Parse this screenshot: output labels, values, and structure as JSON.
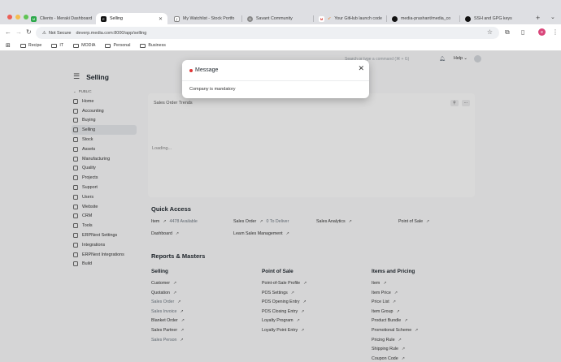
{
  "browser": {
    "tabs": [
      {
        "title": "Clients - Meraki Dashboard",
        "favicon_color": "#2ba84a",
        "favicon_glyph": "M"
      },
      {
        "title": "Selling",
        "favicon_color": "#111111",
        "favicon_glyph": "E",
        "active": true
      },
      {
        "title": "My Watchlist - Stock Portfo",
        "favicon_color": "#333333",
        "favicon_glyph": "ƒ"
      },
      {
        "title": "Savant Community",
        "favicon_color": "#888888",
        "favicon_glyph": "S"
      },
      {
        "title": "Your GitHub launch code",
        "favicon_color": "#ffffff",
        "favicon_glyph": "M"
      },
      {
        "title": "media-prashant/media_co",
        "favicon_color": "#111111",
        "favicon_glyph": "●"
      },
      {
        "title": "SSH and GPG keys",
        "favicon_color": "#111111",
        "favicon_glyph": "●"
      }
    ],
    "secure_label": "Not Secure",
    "url": "deverp.media.com:8000/app/selling",
    "profile_initial": "e",
    "bookmarks": [
      "Recipe",
      "IT",
      "MODIA",
      "Personal",
      "Business"
    ]
  },
  "navbar": {
    "search_placeholder": "Search or type a command (⌘ + G)",
    "help": "Help"
  },
  "workspace": {
    "title": "Selling",
    "section": "PUBLIC",
    "items": [
      "Home",
      "Accounting",
      "Buying",
      "Selling",
      "Stock",
      "Assets",
      "Manufacturing",
      "Quality",
      "Projects",
      "Support",
      "Users",
      "Website",
      "CRM",
      "Tools",
      "ERPNext Settings",
      "Integrations",
      "ERPNext Integrations",
      "Build"
    ],
    "active_item": "Selling"
  },
  "chart_card": {
    "title": "Sales Order Trends",
    "loading": "Loading..."
  },
  "quick_access": {
    "title": "Quick Access",
    "items": [
      {
        "label": "Item",
        "sub": "4478 Available"
      },
      {
        "label": "Sales Order",
        "sub": "0 To Deliver"
      },
      {
        "label": "Sales Analytics",
        "sub": ""
      },
      {
        "label": "Point of Sale",
        "sub": ""
      },
      {
        "label": "Dashboard",
        "sub": ""
      },
      {
        "label": "Learn Sales Management",
        "sub": ""
      }
    ]
  },
  "reports": {
    "title": "Reports & Masters",
    "columns": [
      {
        "title": "Selling",
        "links": [
          "Customer",
          "Quotation",
          "Sales Order",
          "Sales Invoice",
          "Blanket Order",
          "Sales Partner",
          "Sales Person"
        ]
      },
      {
        "title": "Point of Sale",
        "links": [
          "Point-of-Sale Profile",
          "POS Settings",
          "POS Opening Entry",
          "POS Closing Entry",
          "Loyalty Program",
          "Loyalty Point Entry"
        ]
      },
      {
        "title": "Items and Pricing",
        "links": [
          "Item",
          "Item Price",
          "Price List",
          "Item Group",
          "Product Bundle",
          "Promotional Scheme",
          "Pricing Rule",
          "Shipping Rule",
          "Coupon Code"
        ]
      }
    ]
  },
  "modal": {
    "title": "Message",
    "body": "Company is mandatory",
    "indicator_color": "#e03636"
  }
}
